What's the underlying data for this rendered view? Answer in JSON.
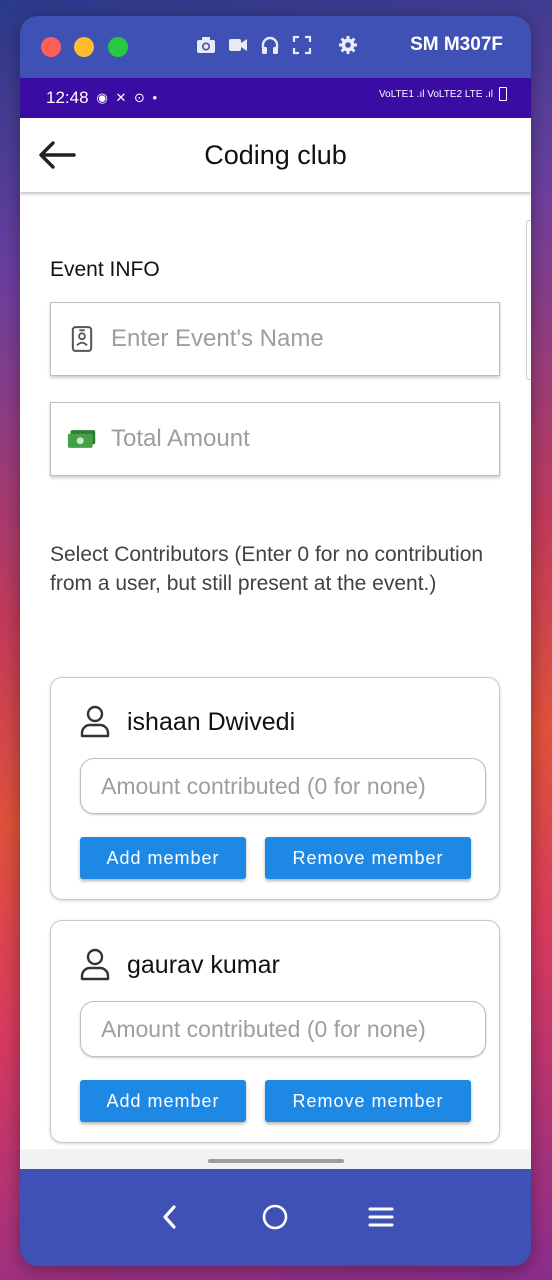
{
  "window": {
    "device_name": "SM M307F",
    "toolbar_icons": [
      "camera-icon",
      "video-icon",
      "headphones-icon",
      "fullscreen-icon",
      "gear-icon"
    ]
  },
  "statusbar": {
    "time": "12:48",
    "left_icons": "◉ ✕ ⊙ •",
    "right_text": "VoLTE1 .ıl VoLTE2 LTE .ıl"
  },
  "appbar": {
    "title": "Coding club",
    "back_icon": "arrow-left-icon"
  },
  "form": {
    "section_label": "Event INFO",
    "event_name": {
      "placeholder": "Enter Event's Name",
      "value": "",
      "icon": "id-badge-icon"
    },
    "total_amount": {
      "placeholder": "Total Amount",
      "value": "",
      "icon": "money-icon"
    },
    "instructions": "Select Contributors (Enter 0 for no contribution from a user, but still present at the event.)"
  },
  "contributors": [
    {
      "name": "ishaan Dwivedi",
      "amount_placeholder": "Amount contributed (0 for none)",
      "add_label": "Add member",
      "remove_label": "Remove member"
    },
    {
      "name": "gaurav kumar",
      "amount_placeholder": "Amount contributed (0 for none)",
      "add_label": "Add member",
      "remove_label": "Remove member"
    }
  ],
  "navbar": {
    "icons": [
      "back-nav-icon",
      "home-nav-icon",
      "recents-nav-icon"
    ]
  },
  "colors": {
    "primary": "#3f51b5",
    "statusbar": "#3a0ca3",
    "button": "#1e88e5"
  }
}
